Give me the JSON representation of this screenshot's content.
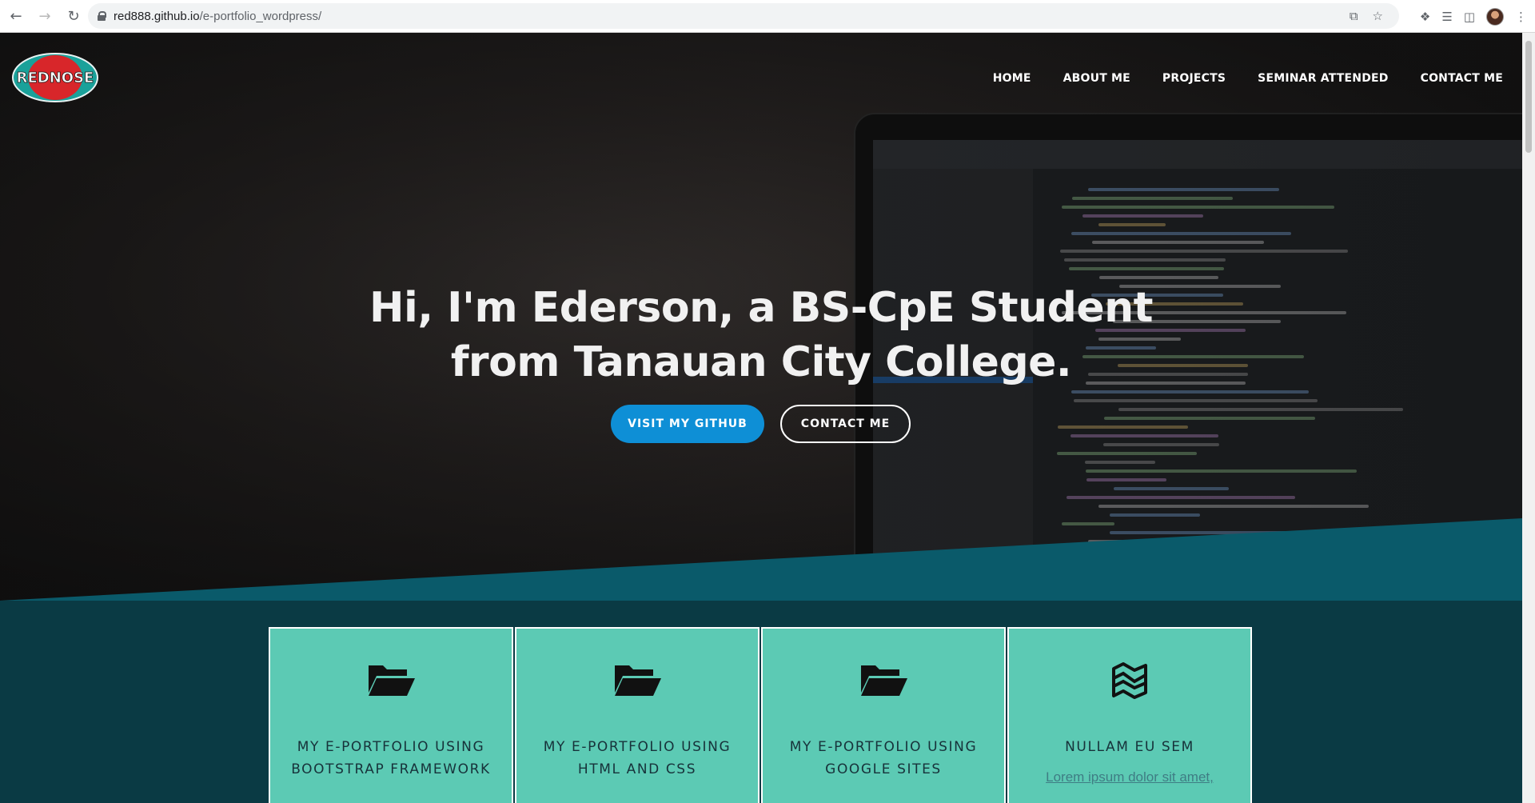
{
  "browser": {
    "url_host": "red888.github.io",
    "url_path": "/e-portfolio_wordpress/",
    "icons": [
      "back-arrow-icon",
      "forward-arrow-icon",
      "reload-icon",
      "lock-icon",
      "share-icon",
      "star-icon",
      "extensions-icon",
      "media-icon",
      "sidepanel-icon",
      "menu-icon"
    ]
  },
  "site": {
    "logo_text": "REDNOSE",
    "nav": [
      "HOME",
      "ABOUT ME",
      "PROJECTS",
      "SEMINAR ATTENDED",
      "CONTACT ME"
    ],
    "headline_line1": "Hi, I'm Ederson, a BS-CpE Student",
    "headline_line2": "from Tanauan City College.",
    "primary_button": "VISIT MY GITHUB",
    "secondary_button": "CONTACT ME"
  },
  "features": [
    {
      "icon": "folder-open-icon",
      "title_line1": "MY E-PORTFOLIO USING",
      "title_line2": "BOOTSTRAP FRAMEWORK"
    },
    {
      "icon": "folder-open-icon",
      "title_line1": "MY E-PORTFOLIO USING",
      "title_line2": "HTML AND CSS"
    },
    {
      "icon": "folder-open-icon",
      "title_line1": "MY E-PORTFOLIO USING",
      "title_line2": "GOOGLE SITES"
    },
    {
      "icon": "map-icon",
      "title_line1": "NULLAM EU SEM",
      "title_line2": "",
      "link_text": "Lorem ipsum dolor sit amet,"
    }
  ],
  "colors": {
    "accent_blue": "#0e8fd6",
    "teal_band": "#0a5a6a",
    "card_teal": "#5ccab4",
    "dark_teal": "#0a3a44"
  }
}
